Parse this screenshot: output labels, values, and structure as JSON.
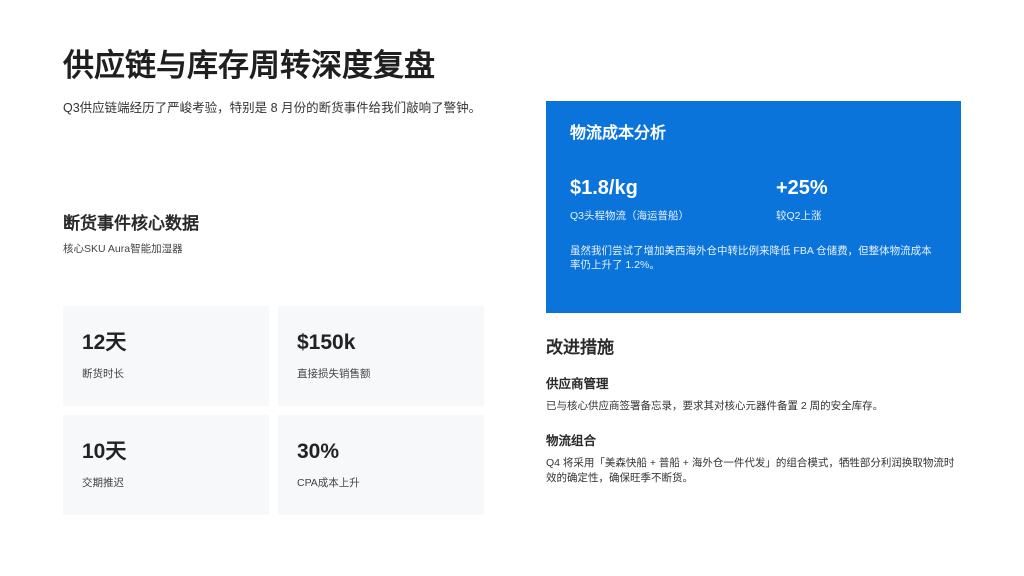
{
  "header": {
    "title": "供应链与库存周转深度复盘",
    "subtitle": "Q3供应链端经历了严峻考验，特别是 8 月份的断货事件给我们敲响了警钟。"
  },
  "stockout": {
    "title": "断货事件核心数据",
    "subtitle": "核心SKU Aura智能加湿器",
    "stats": [
      {
        "value": "12天",
        "label": "断货时长"
      },
      {
        "value": "$150k",
        "label": "直接损失销售额"
      },
      {
        "value": "10天",
        "label": "交期推迟"
      },
      {
        "value": "30%",
        "label": "CPA成本上升"
      }
    ]
  },
  "logistics": {
    "title": "物流成本分析",
    "metrics": [
      {
        "value": "$1.8/kg",
        "label": "Q3头程物流（海运普船）"
      },
      {
        "value": "+25%",
        "label": "较Q2上涨"
      }
    ],
    "note": "虽然我们尝试了增加美西海外仓中转比例来降低 FBA 仓储费，但整体物流成本率仍上升了 1.2%。",
    "accent_color": "#0a74db"
  },
  "improvements": {
    "title": "改进措施",
    "items": [
      {
        "title": "供应商管理",
        "desc": "已与核心供应商签署备忘录，要求其对核心元器件备置 2 周的安全库存。"
      },
      {
        "title": "物流组合",
        "desc": "Q4 将采用「美森快船 + 普船 + 海外仓一件代发」的组合模式，牺牲部分利润换取物流时效的确定性，确保旺季不断货。"
      }
    ]
  }
}
